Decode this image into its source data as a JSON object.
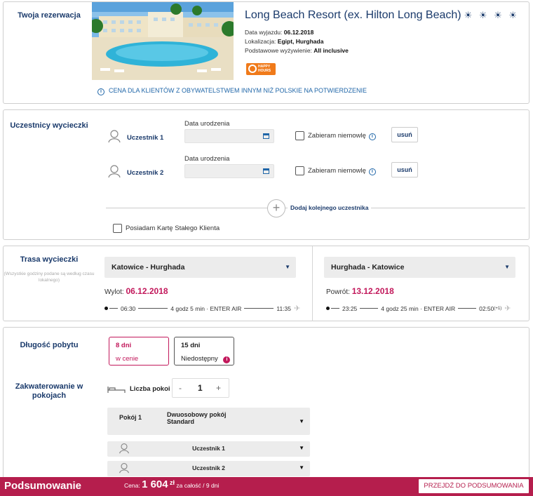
{
  "reservation": {
    "section_label": "Twoja rezerwacja",
    "hotel_name": "Long Beach Resort (ex. Hilton Long Beach)",
    "stars": "☀ ☀ ☀ ☀",
    "departure_label": "Data wyjazdu:",
    "departure_value": "06.12.2018",
    "location_label": "Lokalizacja:",
    "location_value": "Egipt, Hurghada",
    "board_label": "Podstawowe wyżywienie:",
    "board_value": "All inclusive",
    "badge_line1": "HAPPY",
    "badge_line2": "HOURS",
    "notice": "CENA DLA KLIENTÓW Z OBYWATELSTWEM INNYM NIŻ POLSKIE NA POTWIERDZENIE"
  },
  "participants": {
    "section_label": "Uczestnicy wycieczki",
    "dob_label": "Data urodzenia",
    "infant_label": "Zabieram niemowlę",
    "remove_label": "usuń",
    "items": [
      {
        "name": "Uczestnik 1"
      },
      {
        "name": "Uczestnik 2"
      }
    ],
    "add_label": "Dodaj kolejnego uczestnika",
    "add_symbol": "+",
    "loyalty_label": "Posiadam Kartę Stałego Klienta"
  },
  "route": {
    "section_label": "Trasa wycieczki",
    "note": "(Wszystkie godziny podane są według czasu lokalnego)",
    "outbound": {
      "select": "Katowice - Hurghada",
      "date_label": "Wylot:",
      "date": "06.12.2018",
      "dep": "06:30",
      "info": "4 godz 5 min · ENTER AIR",
      "arr": "11:35",
      "arr_suffix": ""
    },
    "inbound": {
      "select": "Hurghada - Katowice",
      "date_label": "Powrót:",
      "date": "13.12.2018",
      "dep": "23:25",
      "info": "4 godz 25 min · ENTER AIR",
      "arr": "02:50",
      "arr_suffix": "(+1)"
    }
  },
  "stay": {
    "length_label": "Długość pobytu",
    "options": [
      {
        "title": "8 dni",
        "sub": "w cenie"
      },
      {
        "title": "15 dni",
        "sub": "Niedostępny"
      }
    ],
    "rooms_section_label": "Zakwaterowanie w pokojach",
    "rooms_count_label": "Liczba pokoi",
    "rooms_count": "1",
    "minus": "-",
    "plus": "+",
    "room_label": "Pokój 1",
    "room_type": "Dwuosobowy pokój Standard",
    "room_participants": [
      "Uczestnik 1",
      "Uczestnik 2"
    ]
  },
  "footer": {
    "title": "Podsumowanie",
    "price_label": "Cena:",
    "price_value": "1 604",
    "currency": "zł",
    "price_suffix": "za całość / 9 dni",
    "cta": "PRZEJDŹ DO PODSUMOWANIA"
  },
  "colors": {
    "accent": "#b51e4d",
    "navy": "#1a3a6b",
    "link": "#1f66a8",
    "badge": "#f07a1a"
  }
}
